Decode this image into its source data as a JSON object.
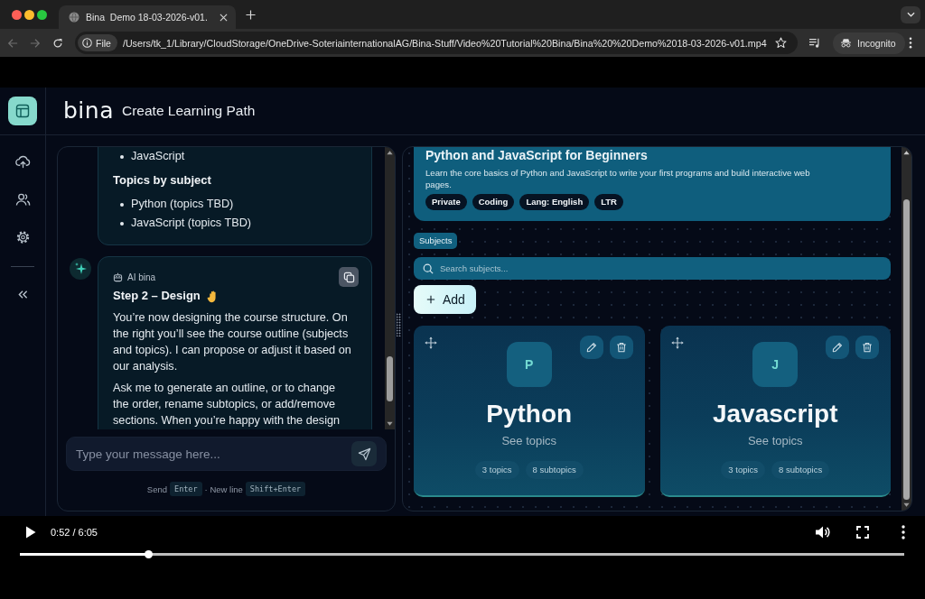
{
  "browser": {
    "tabs": [
      {
        "title": "Bina  Demo 18-03-2026-v01.",
        "selected": true
      }
    ],
    "nav": [
      {
        "kind": "back",
        "disabled": true
      },
      {
        "kind": "forward",
        "disabled": true
      },
      {
        "kind": "reload",
        "disabled": false
      }
    ],
    "address": {
      "chip": "File",
      "url": "/Users/tk_1/Library/CloudStorage/OneDrive-SoteriainternationalAG/Bina-Stuff/Video%20Tutorial%20Bina/Bina%20%20Demo%2018-03-2026-v01.mp4"
    },
    "profile": "Incognito"
  },
  "app": {
    "logo": "bina",
    "title": "Create Learning Path"
  },
  "chat": {
    "messages": [
      {
        "blocks": [
          {
            "kind": "list",
            "items": [
              "JavaScript"
            ]
          },
          {
            "kind": "heading",
            "text": "Topics by subject"
          },
          {
            "kind": "list",
            "items": [
              "Python (topics TBD)",
              "JavaScript (topics TBD)"
            ]
          }
        ]
      },
      {
        "author": "AI bina",
        "blocks": [
          {
            "kind": "step-title",
            "text": "Step 2 – Design"
          },
          {
            "kind": "paragraph",
            "text": "You’re now designing the course structure. On the right you’ll see the course outline (subjects and topics). I can propose or adjust it based on our analysis."
          },
          {
            "kind": "paragraph",
            "text": "Ask me to generate an outline, or to change the order, rename subtopics, or add/remove sections. When you’re happy with the design"
          }
        ]
      }
    ],
    "input": {
      "placeholder": "Type your message here..."
    },
    "hint": [
      {
        "kind": "text",
        "text": "Send"
      },
      {
        "kind": "key",
        "text": "Enter"
      },
      {
        "kind": "text",
        "text": "· New line"
      },
      {
        "kind": "key",
        "text": "Shift+Enter"
      }
    ]
  },
  "course": {
    "title": "Python and JavaScript for Beginners",
    "description": "Learn the core basics of Python and JavaScript to write your first programs and build interactive web pages.",
    "tags": [
      "Private",
      "Coding",
      "Lang: English",
      "LTR"
    ]
  },
  "subjects": {
    "label": "Subjects",
    "search": {
      "placeholder": "Search subjects..."
    },
    "add_button": "Add",
    "cards": [
      {
        "initial": "P",
        "name": "Python",
        "link": "See topics",
        "counts": [
          "3 topics",
          "8 subtopics"
        ]
      },
      {
        "initial": "J",
        "name": "Javascript",
        "link": "See topics",
        "counts": [
          "3 topics",
          "8 subtopics"
        ]
      }
    ]
  },
  "video": {
    "time": "0:52 / 6:05",
    "progress": {
      "level": 0.146
    }
  }
}
